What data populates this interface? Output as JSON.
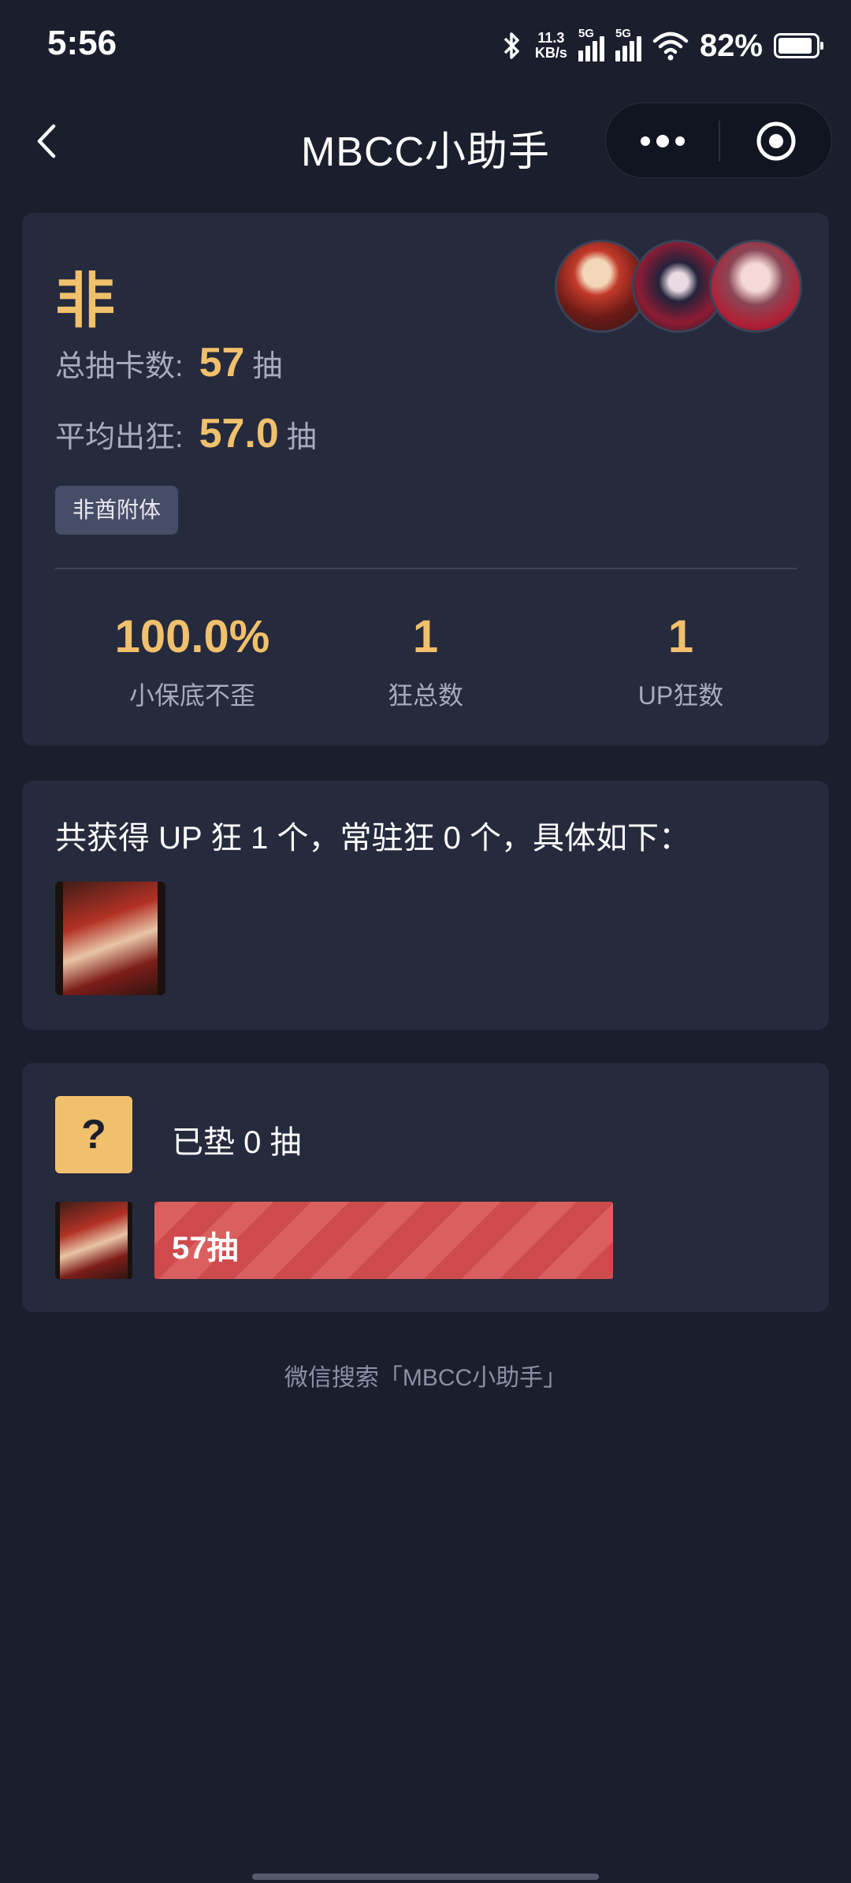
{
  "status_bar": {
    "time": "5:56",
    "net_speed_value": "11.3",
    "net_speed_unit": "KB/s",
    "sim1": "5G",
    "sim2": "5G",
    "battery": "82%"
  },
  "nav": {
    "title": "MBCC小助手"
  },
  "summary_card": {
    "rank": "非",
    "total_label": "总抽卡数:",
    "total_value": "57",
    "total_unit": "抽",
    "avg_label": "平均出狂:",
    "avg_value": "57.0",
    "avg_unit": "抽",
    "badge": "非酋附体",
    "metrics": [
      {
        "value": "100.0%",
        "label": "小保底不歪"
      },
      {
        "value": "1",
        "label": "狂总数"
      },
      {
        "value": "1",
        "label": "UP狂数"
      }
    ]
  },
  "obtained_card": {
    "summary": "共获得 UP 狂 1 个，常驻狂 0 个，具体如下："
  },
  "pity_card": {
    "unknown_mark": "?",
    "pity_text": "已垫 0 抽",
    "pull_bar_label": "57抽",
    "pull_bar_fraction": 0.57
  },
  "footer": "微信搜索「MBCC小助手」",
  "colors": {
    "background": "#1b1e2d",
    "card": "#262a3d",
    "accent": "#f0c06c",
    "bar": "#cf4a4d"
  }
}
